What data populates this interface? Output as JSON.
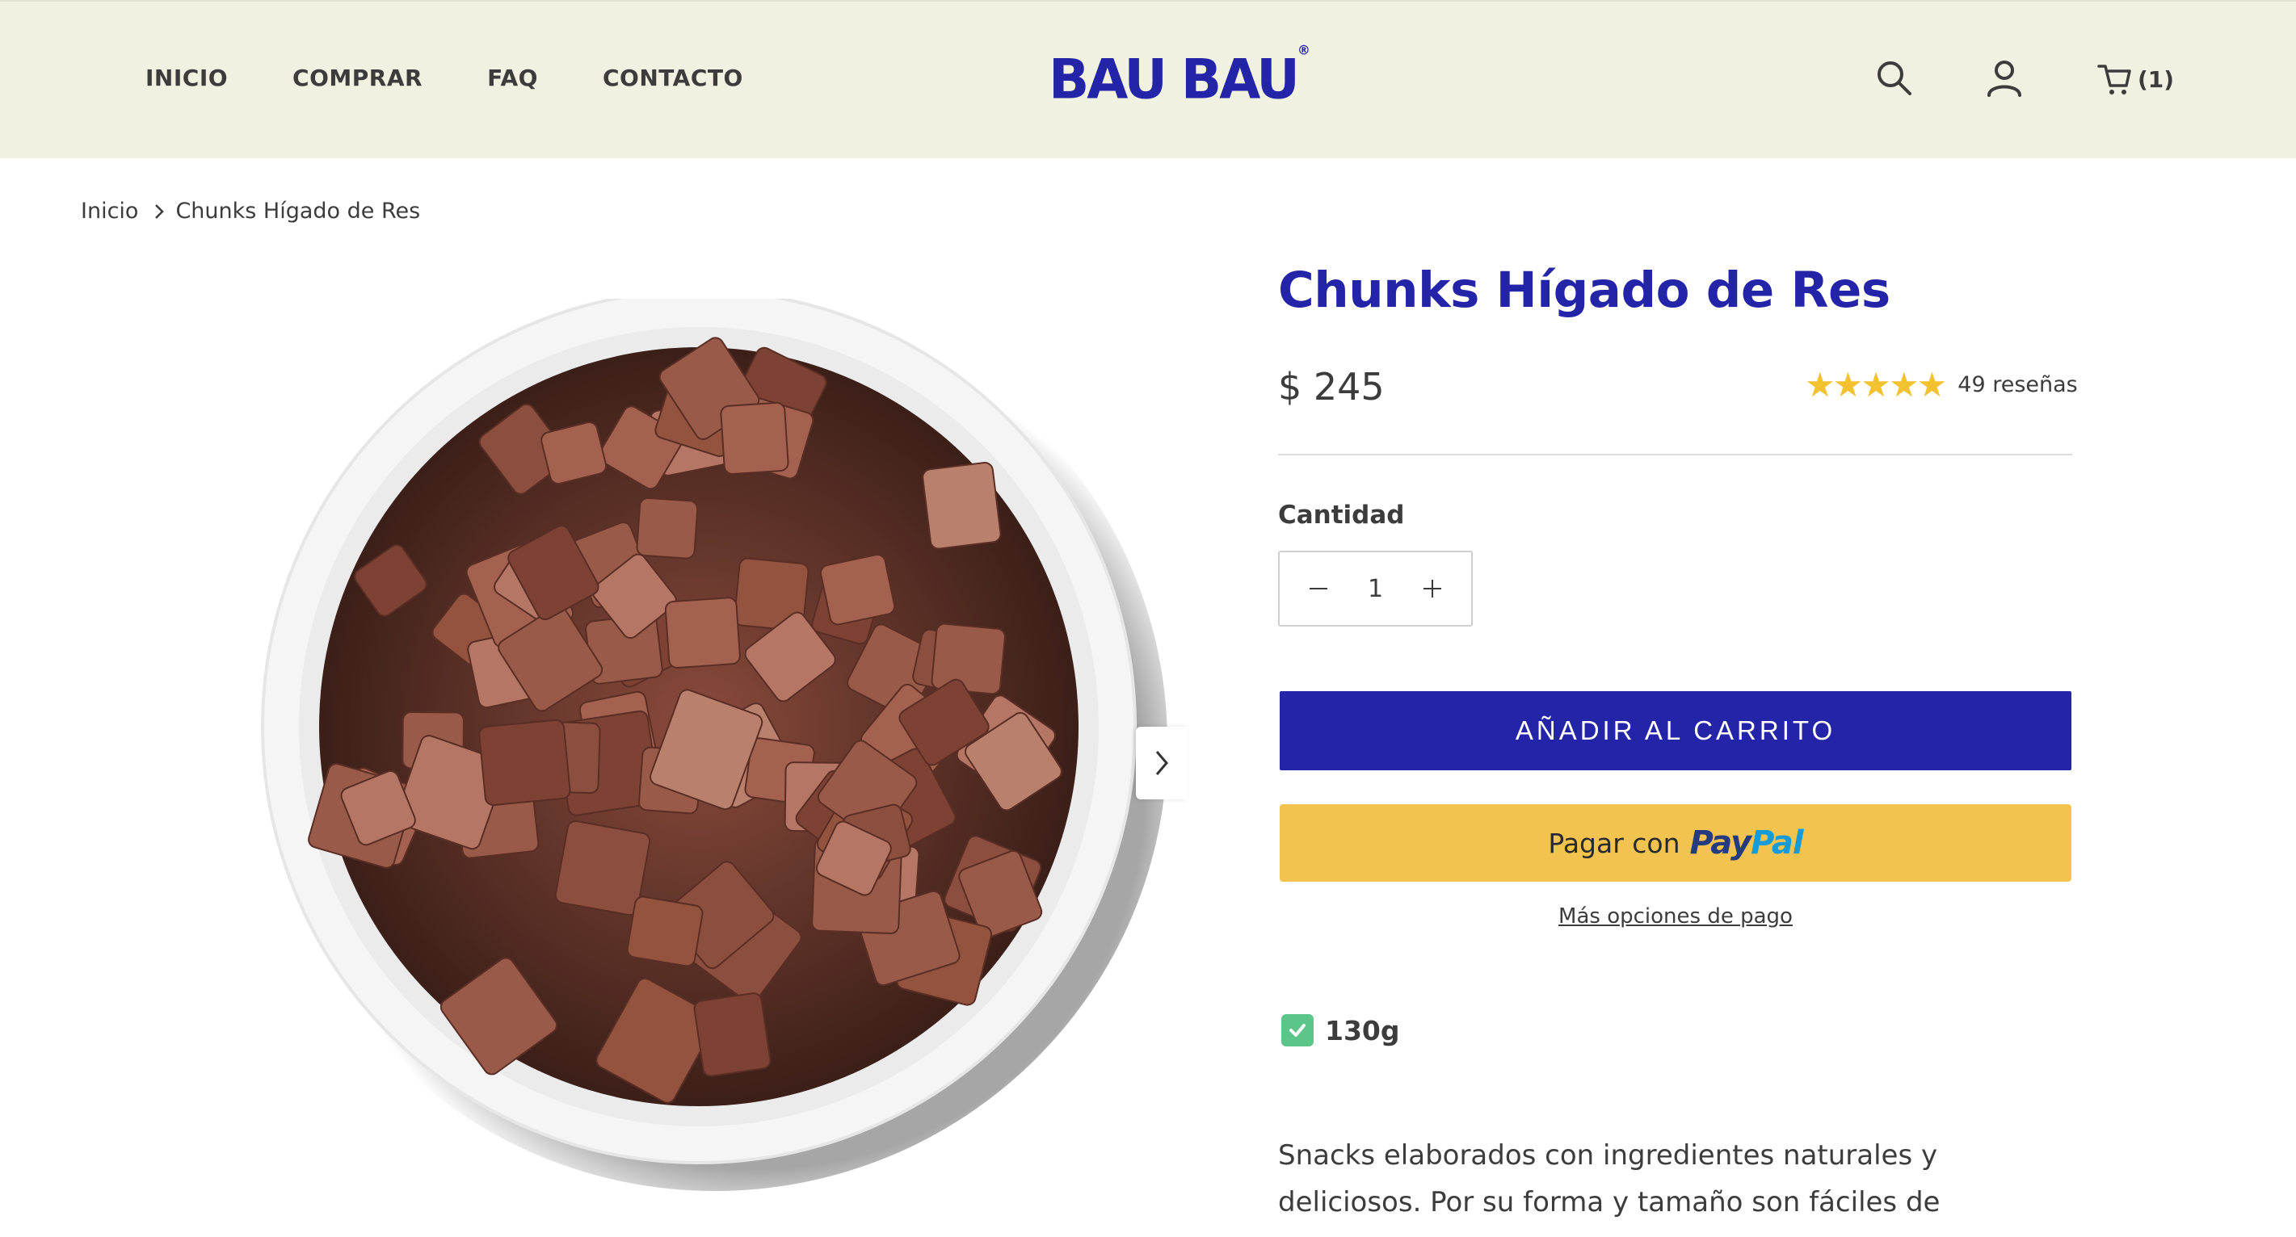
{
  "header": {
    "nav": [
      "INICIO",
      "COMPRAR",
      "FAQ",
      "CONTACTO"
    ],
    "logo": "BAU BAU",
    "logo_mark": "®",
    "icons": [
      "search-icon",
      "user-icon",
      "cart-icon"
    ],
    "cart_count": "(1)"
  },
  "breadcrumb": {
    "home": "Inicio",
    "current": "Chunks Hígado de Res"
  },
  "product": {
    "title": "Chunks Hígado de Res",
    "price": "$ 245",
    "stars": "★★★★★",
    "rating": 5,
    "reviews": "49 reseñas",
    "quantity_label": "Cantidad",
    "quantity": "1",
    "add_to_cart": "AÑADIR AL CARRITO",
    "paypal_prefix": "Pagar con",
    "paypal_brand_1": "Pay",
    "paypal_brand_2": "Pal",
    "more_payment": "Más opciones de pago",
    "variant": "130g",
    "description": "Snacks elaborados con ingredientes naturales y deliciosos. Por su forma y tamaño son fáciles de administrar y perfectos para"
  },
  "colors": {
    "brand_blue": "#2324a8",
    "header_bg": "#f1f1e1",
    "paypal_yellow": "#f2c44f",
    "star_yellow": "#f2c230",
    "check_green": "#5cc68a"
  }
}
